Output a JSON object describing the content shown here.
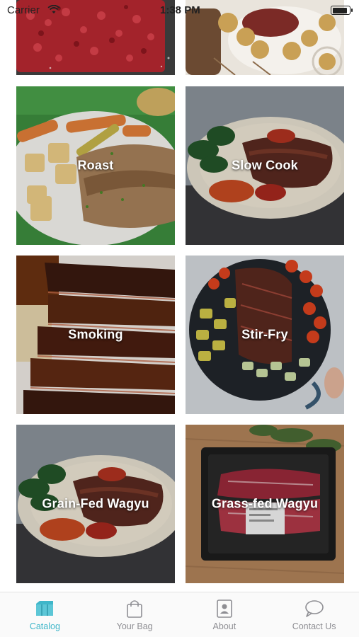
{
  "status_bar": {
    "carrier": "Carrier",
    "time": "1:38 PM",
    "battery_level": 0.9
  },
  "catalog": {
    "top_row": [
      {
        "label": "",
        "icon": "ground-beef-image"
      },
      {
        "label": "",
        "icon": "roast-potatoes-image"
      }
    ],
    "categories": [
      {
        "label": "Roast",
        "icon": "roast-image"
      },
      {
        "label": "Slow Cook",
        "icon": "slow-cook-image"
      },
      {
        "label": "Smoking",
        "icon": "smoking-image"
      },
      {
        "label": "Stir-Fry",
        "icon": "stir-fry-image"
      },
      {
        "label": "Grain-Fed Wagyu",
        "icon": "grain-fed-wagyu-image"
      },
      {
        "label": "Grass-fed Wagyu",
        "icon": "grass-fed-wagyu-image"
      }
    ]
  },
  "tab_bar": {
    "tabs": [
      {
        "label": "Catalog",
        "icon": "catalog-icon",
        "active": true
      },
      {
        "label": "Your Bag",
        "icon": "bag-icon",
        "active": false
      },
      {
        "label": "About",
        "icon": "about-icon",
        "active": false
      },
      {
        "label": "Contact Us",
        "icon": "contact-icon",
        "active": false
      }
    ],
    "active_color": "#3fb6c9",
    "inactive_color": "#8e8e93"
  }
}
